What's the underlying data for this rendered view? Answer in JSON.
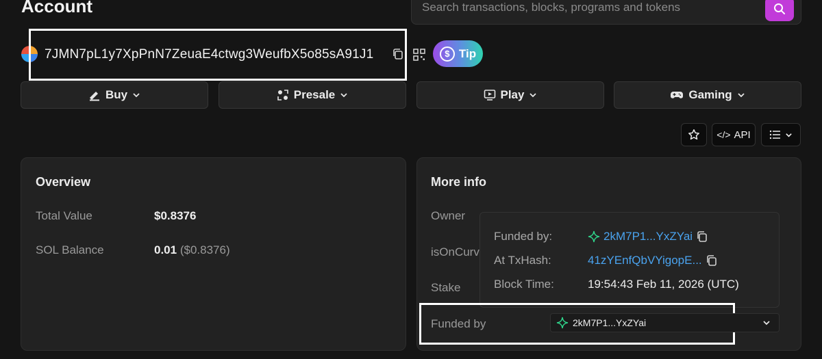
{
  "header": {
    "title": "Account",
    "search_placeholder": "Search transactions, blocks, programs and tokens"
  },
  "account": {
    "address": "7JMN7pL1y7XpPnN7ZeuaE4ctwg3WeufbX5o85sA91J1",
    "tip_label": "Tip"
  },
  "actions": [
    {
      "label": "Buy",
      "icon": "buy-icon"
    },
    {
      "label": "Presale",
      "icon": "presale-icon"
    },
    {
      "label": "Play",
      "icon": "play-icon"
    },
    {
      "label": "Gaming",
      "icon": "gamepad-icon"
    }
  ],
  "toolbar": {
    "api_label": "API"
  },
  "overview": {
    "title": "Overview",
    "rows": [
      {
        "label": "Total Value",
        "value": "$0.8376",
        "sub": ""
      },
      {
        "label": "SOL Balance",
        "value": "0.01",
        "sub": "($0.8376)"
      }
    ]
  },
  "more_info": {
    "title": "More info",
    "owner_label": "Owner",
    "is_on_curve_label": "isOnCurv",
    "stake_label": "Stake",
    "funded_by_label": "Funded by",
    "funded_by_value": "2kM7P1...YxZYai"
  },
  "popover": {
    "funded_by_label": "Funded by:",
    "funded_by_value": "2kM7P1...YxZYai",
    "tx_hash_label": "At TxHash:",
    "tx_hash_value": "41zYEnfQbVYigopE...",
    "block_time_label": "Block Time:",
    "block_time_value": "19:54:43 Feb 11, 2026 (UTC)"
  },
  "colors": {
    "accent": "#c13bd9",
    "link": "#4aa3ef",
    "funder_icon": "#2fd38a"
  }
}
